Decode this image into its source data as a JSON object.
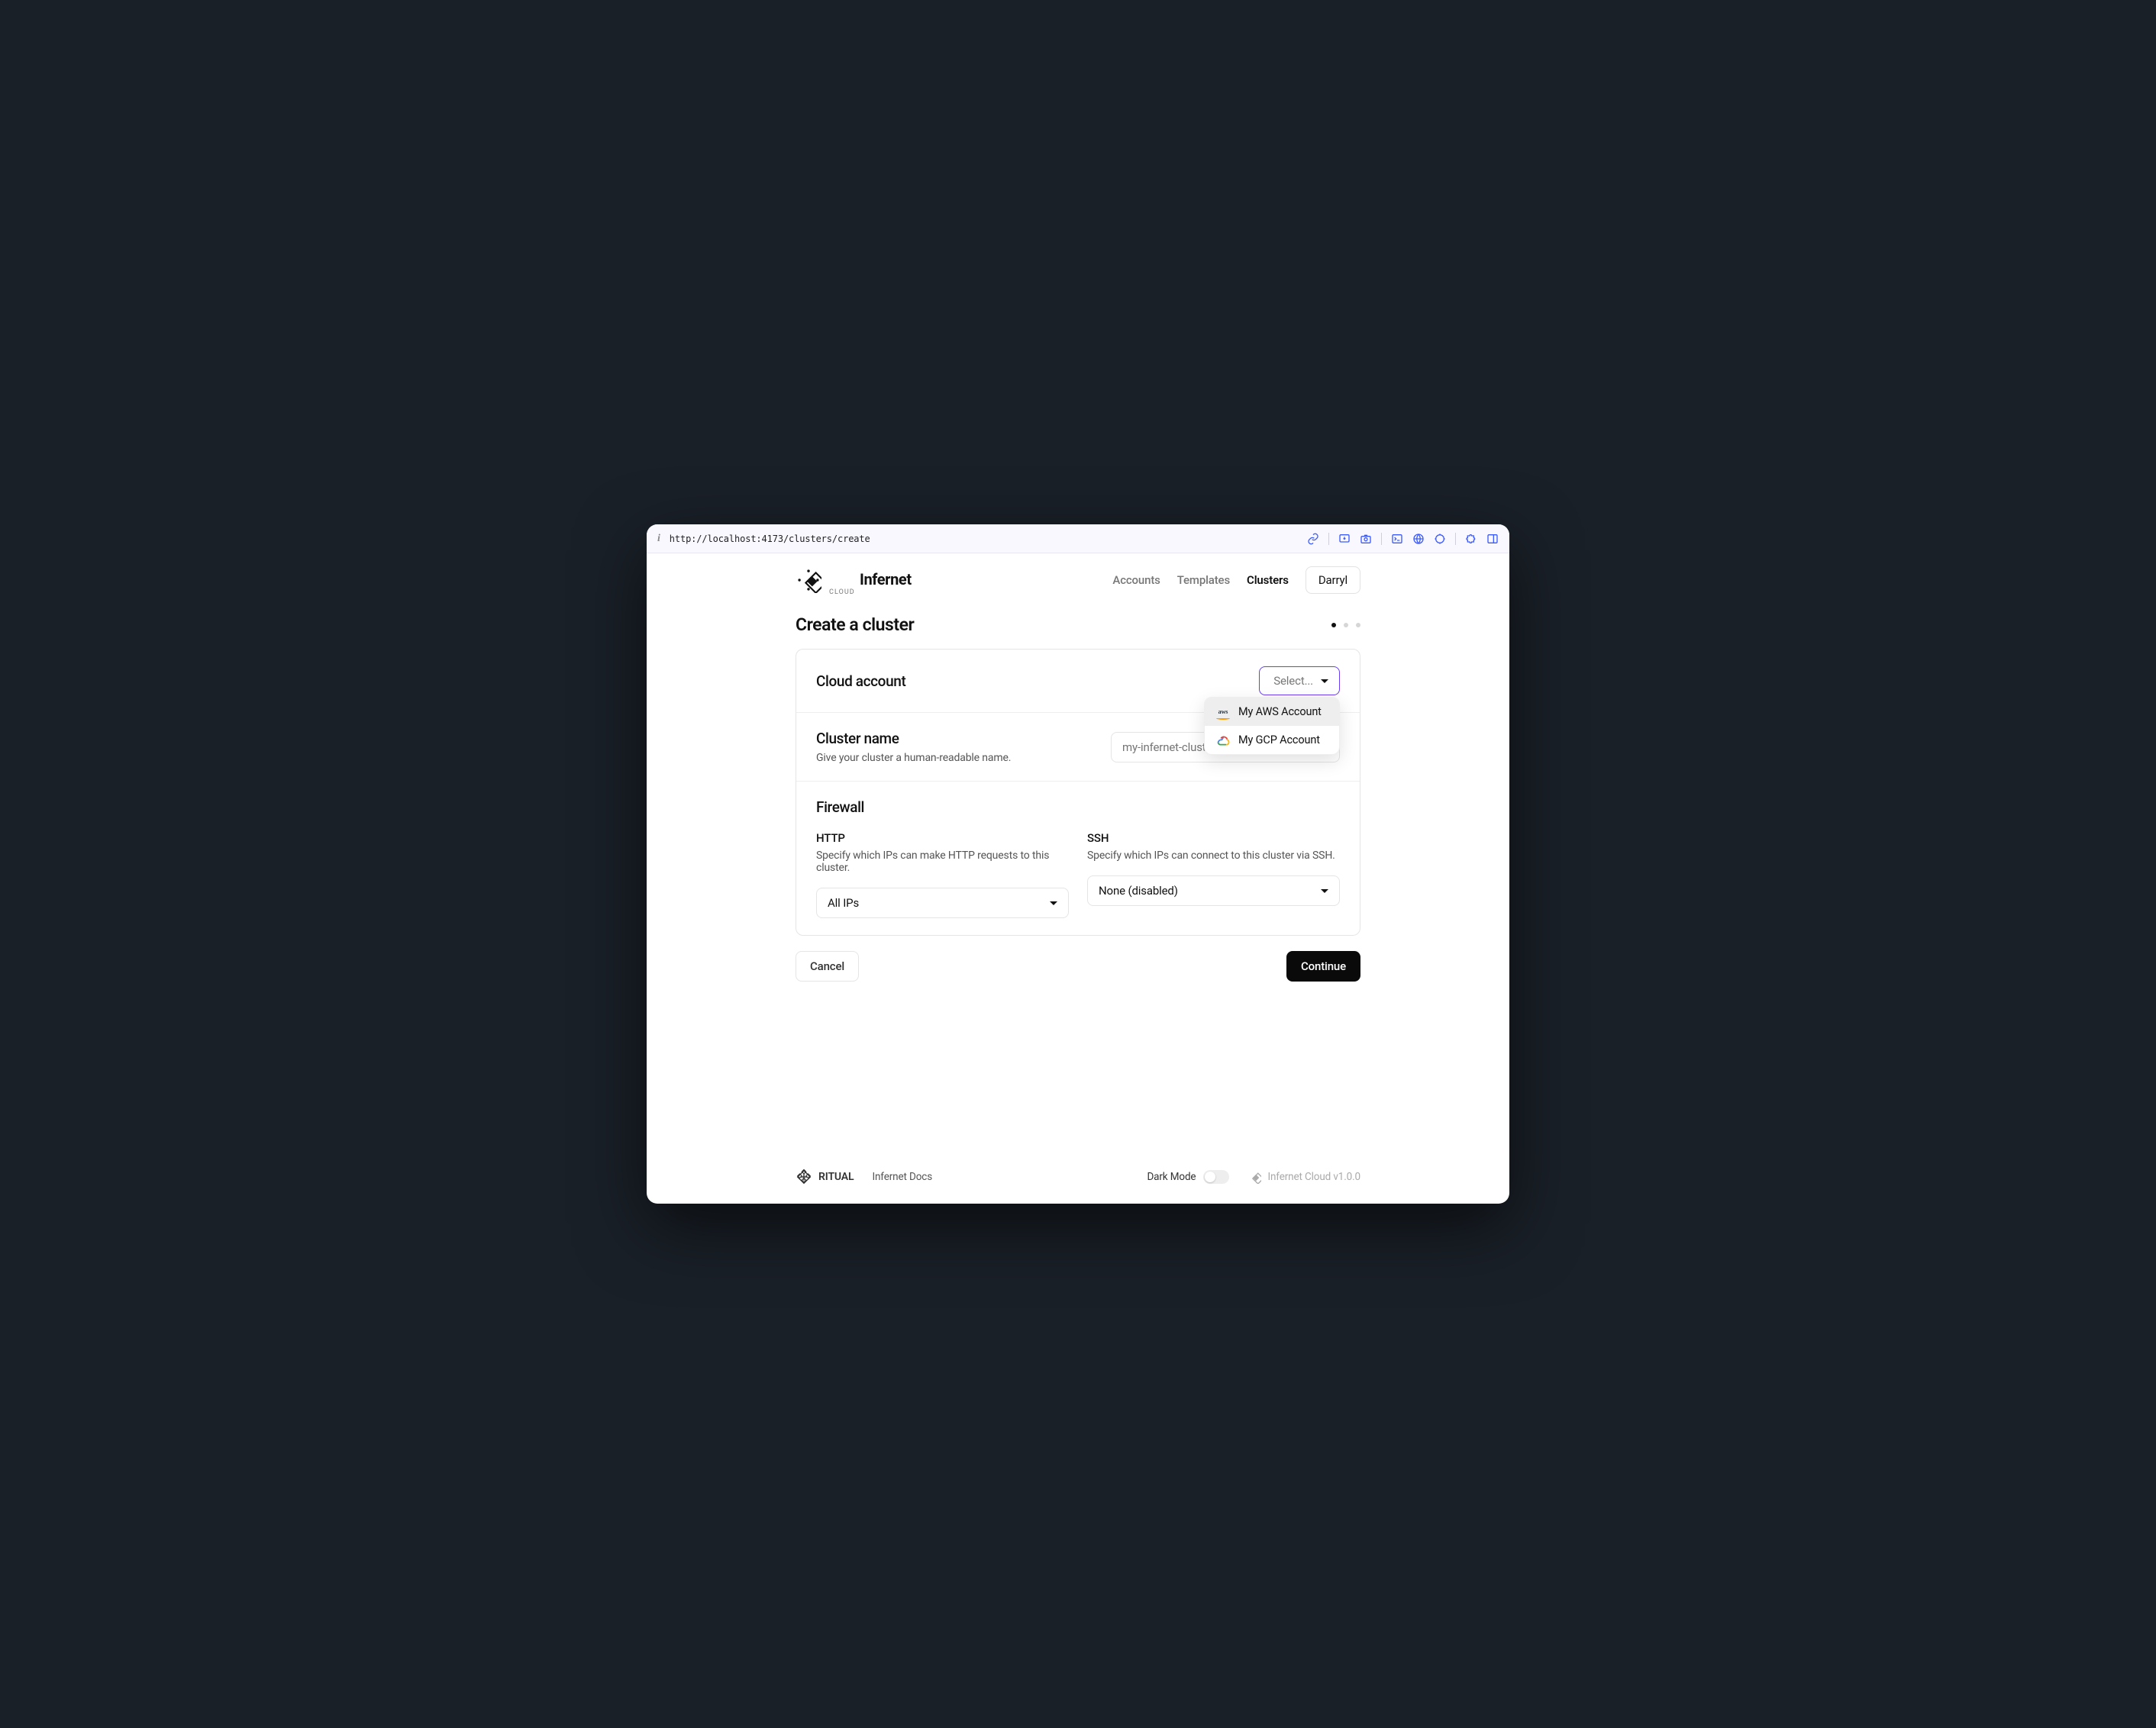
{
  "url_bar": {
    "url": "http://localhost:4173/clusters/create"
  },
  "header": {
    "brand_main": "Infernet",
    "brand_sub": "CLOUD",
    "nav": {
      "accounts": "Accounts",
      "templates": "Templates",
      "clusters": "Clusters"
    },
    "user_label": "Darryl"
  },
  "page": {
    "title": "Create a cluster",
    "steps_total": 3,
    "step_active": 1
  },
  "cloud_account": {
    "label": "Cloud account",
    "select_placeholder": "Select...",
    "options": [
      {
        "label": "My AWS Account"
      },
      {
        "label": "My GCP Account"
      }
    ]
  },
  "cluster_name": {
    "label": "Cluster name",
    "desc": "Give your cluster a human-readable name.",
    "placeholder": "my-infernet-cluster"
  },
  "firewall": {
    "title": "Firewall",
    "http": {
      "label": "HTTP",
      "desc": "Specify which IPs can make HTTP requests to this cluster.",
      "value": "All IPs"
    },
    "ssh": {
      "label": "SSH",
      "desc": "Specify which IPs can connect to this cluster via SSH.",
      "value": "None (disabled)"
    }
  },
  "actions": {
    "cancel": "Cancel",
    "continue": "Continue"
  },
  "footer": {
    "ritual": "RITUAL",
    "docs": "Infernet Docs",
    "dark_mode": "Dark Mode",
    "version": "Infernet Cloud v1.0.0"
  }
}
